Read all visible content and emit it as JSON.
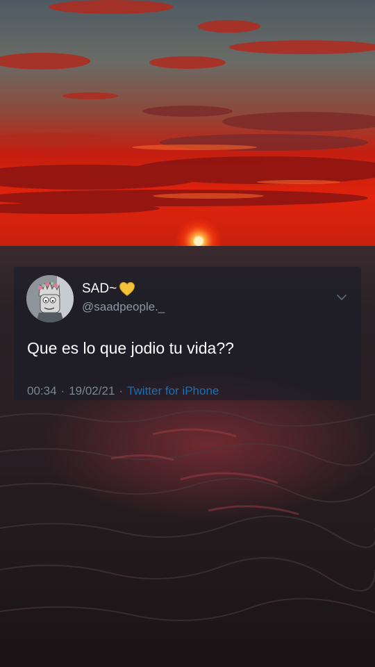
{
  "tweet": {
    "display_name": "SAD~",
    "name_emoji": "yellow-heart-icon",
    "handle": "@saadpeople._",
    "text": "Que es lo que jodio tu vida??",
    "time": "00:34",
    "separator": "·",
    "date": "19/02/21",
    "source": "Twitter for iPhone"
  },
  "colors": {
    "handle": "#8b98a5",
    "meta": "#7a8794",
    "source_link": "#1d6fb0",
    "heart": "#f2c23a"
  }
}
